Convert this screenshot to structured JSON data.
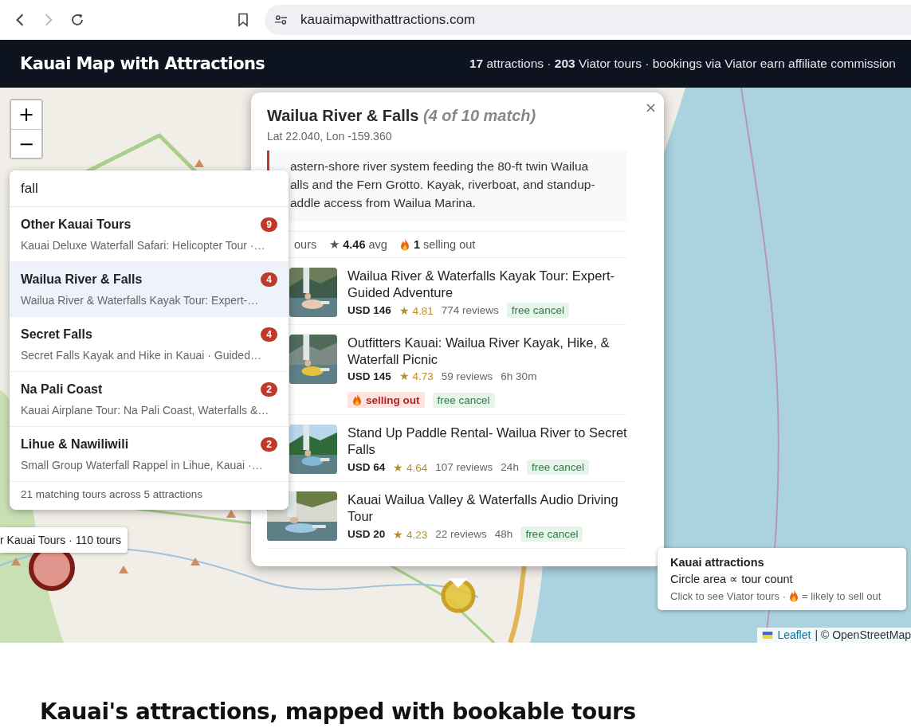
{
  "browser": {
    "url": "kauaimapwithattractions.com",
    "forward_disabled": true
  },
  "header": {
    "title": "Kauai Map with Attractions",
    "summary": "**17** attractions · **203** Viator tours · bookings via Viator earn affiliate commission"
  },
  "map": {
    "zoom_in": "+",
    "zoom_out": "−",
    "search": {
      "value": "fall",
      "results": [
        {
          "name": "Other Kauai Tours",
          "count": "9",
          "preview": "Kauai Deluxe Waterfall Safari: Helicopter Tour ·…",
          "selected": false
        },
        {
          "name": "Wailua River & Falls",
          "count": "4",
          "preview": "Wailua River & Waterfalls Kayak Tour: Expert-…",
          "selected": true
        },
        {
          "name": "Secret Falls",
          "count": "4",
          "preview": "Secret Falls Kayak and Hike in Kauai · Guided…",
          "selected": false
        },
        {
          "name": "Na Pali Coast",
          "count": "2",
          "preview": "Kauai Airplane Tour: Na Pali Coast, Waterfalls &…",
          "selected": false
        },
        {
          "name": "Lihue & Nawiliwili",
          "count": "2",
          "preview": "Small Group Waterfall Rappel in Lihue, Kauai ·…",
          "selected": false
        }
      ],
      "footer": "21 matching tours across 5 attractions"
    },
    "marker_tooltip": "r Kauai Tours · 110 tours",
    "popup": {
      "title": "Wailua River & Falls",
      "match": "(4 of 10 match)",
      "coords": "Lat 22.040, Lon -159.360",
      "description_lines": [
        "astern-shore river system feeding the 80-ft twin Wailua",
        "alls and the Fern Grotto. Kayak, riverboat, and standup-",
        "addle access from Wailua Marina."
      ],
      "stats": {
        "tours": "ours",
        "avg": "★ **4.46** avg",
        "selling_out": "**1** selling out"
      },
      "tours": [
        {
          "title": "Wailua River & Waterfalls Kayak Tour: Expert-Guided Adventure",
          "price": "USD 146",
          "rating": "★ 4.81",
          "reviews": "774 reviews",
          "tags": [
            {
              "kind": "free_cancel",
              "label": "free cancel"
            }
          ]
        },
        {
          "title": "Outfitters Kauai: Wailua River Kayak, Hike, & Waterfall Picnic",
          "price": "USD 145",
          "rating": "★ 4.73",
          "reviews": "59 reviews",
          "duration": "6h 30m",
          "tags": [
            {
              "kind": "selling_out",
              "label": "selling out"
            },
            {
              "kind": "free_cancel",
              "label": "free cancel"
            }
          ]
        },
        {
          "title": "Stand Up Paddle Rental- Wailua River to Secret Falls",
          "price": "USD 64",
          "rating": "★ 4.64",
          "reviews": "107 reviews",
          "duration": "24h",
          "tags": [
            {
              "kind": "free_cancel",
              "label": "free cancel"
            }
          ]
        },
        {
          "title": "Kauai Wailua Valley & Waterfalls Audio Driving Tour",
          "price": "USD 20",
          "rating": "★ 4.23",
          "reviews": "22 reviews",
          "duration": "48h",
          "tags": [
            {
              "kind": "free_cancel",
              "label": "free cancel"
            }
          ]
        }
      ]
    },
    "legend": {
      "title": "Kauai attractions",
      "line": "Circle area ∝ tour count",
      "note_before": "Click to see Viator tours ·",
      "note_after": "= likely to sell out"
    },
    "attribution": {
      "link": "Leaflet",
      "text": "| © OpenStreetMap"
    }
  },
  "heading": "Kauai's attractions, mapped with bookable tours"
}
